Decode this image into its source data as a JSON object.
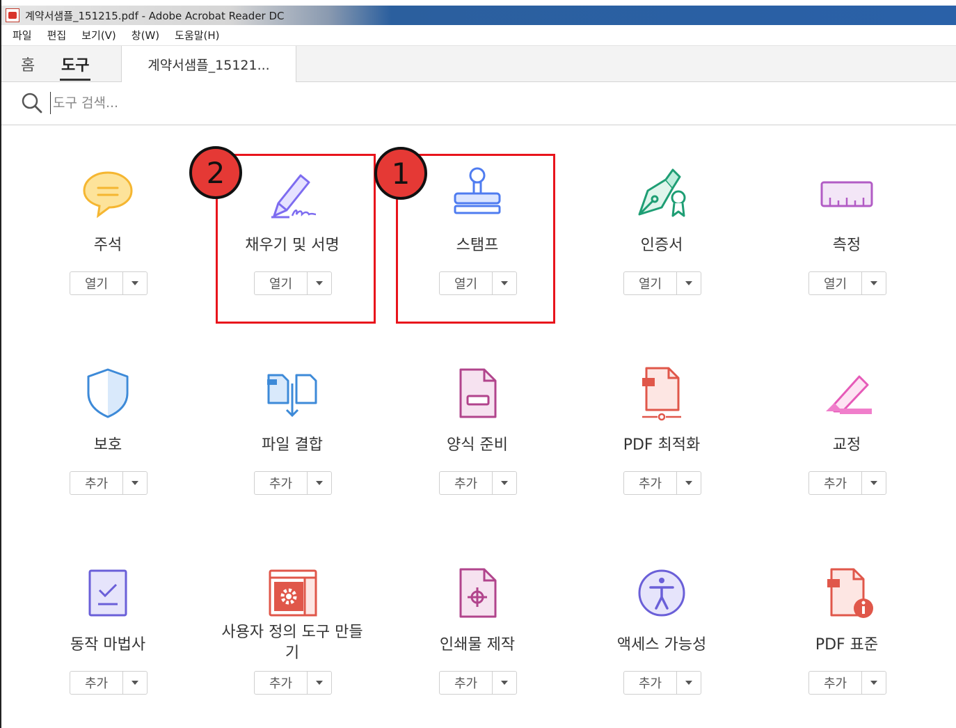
{
  "window": {
    "title": "계약서샘플_151215.pdf - Adobe Acrobat Reader DC"
  },
  "menu": [
    "파일",
    "편집",
    "보기(V)",
    "창(W)",
    "도움말(H)"
  ],
  "tabs": {
    "home": "홈",
    "tools": "도구",
    "document": "계약서샘플_15121..."
  },
  "search": {
    "placeholder": "도구 검색..."
  },
  "tools": [
    {
      "label": "주석",
      "button": "열기",
      "icon": "comment-icon"
    },
    {
      "label": "채우기 및 서명",
      "button": "열기",
      "icon": "fill-sign-icon"
    },
    {
      "label": "스탬프",
      "button": "열기",
      "icon": "stamp-icon"
    },
    {
      "label": "인증서",
      "button": "열기",
      "icon": "certificate-icon"
    },
    {
      "label": "측정",
      "button": "열기",
      "icon": "measure-icon"
    },
    {
      "label": "보호",
      "button": "추가",
      "icon": "protect-icon"
    },
    {
      "label": "파일 결합",
      "button": "추가",
      "icon": "combine-files-icon"
    },
    {
      "label": "양식 준비",
      "button": "추가",
      "icon": "prepare-form-icon"
    },
    {
      "label": "PDF 최적화",
      "button": "추가",
      "icon": "optimize-pdf-icon"
    },
    {
      "label": "교정",
      "button": "추가",
      "icon": "redact-icon"
    },
    {
      "label": "동작 마법사",
      "button": "추가",
      "icon": "action-wizard-icon"
    },
    {
      "label": "사용자 정의 도구 만들기",
      "button": "추가",
      "icon": "custom-tool-icon"
    },
    {
      "label": "인쇄물 제작",
      "button": "추가",
      "icon": "print-production-icon"
    },
    {
      "label": "액세스 가능성",
      "button": "추가",
      "icon": "accessibility-icon"
    },
    {
      "label": "PDF 표준",
      "button": "추가",
      "icon": "pdf-standards-icon"
    }
  ],
  "annotations": {
    "badge_1": "1",
    "badge_2": "2"
  },
  "colors": {
    "highlight": "#e8141c",
    "badge": "#e53935",
    "title_bar_blue": "#2a61a8"
  }
}
